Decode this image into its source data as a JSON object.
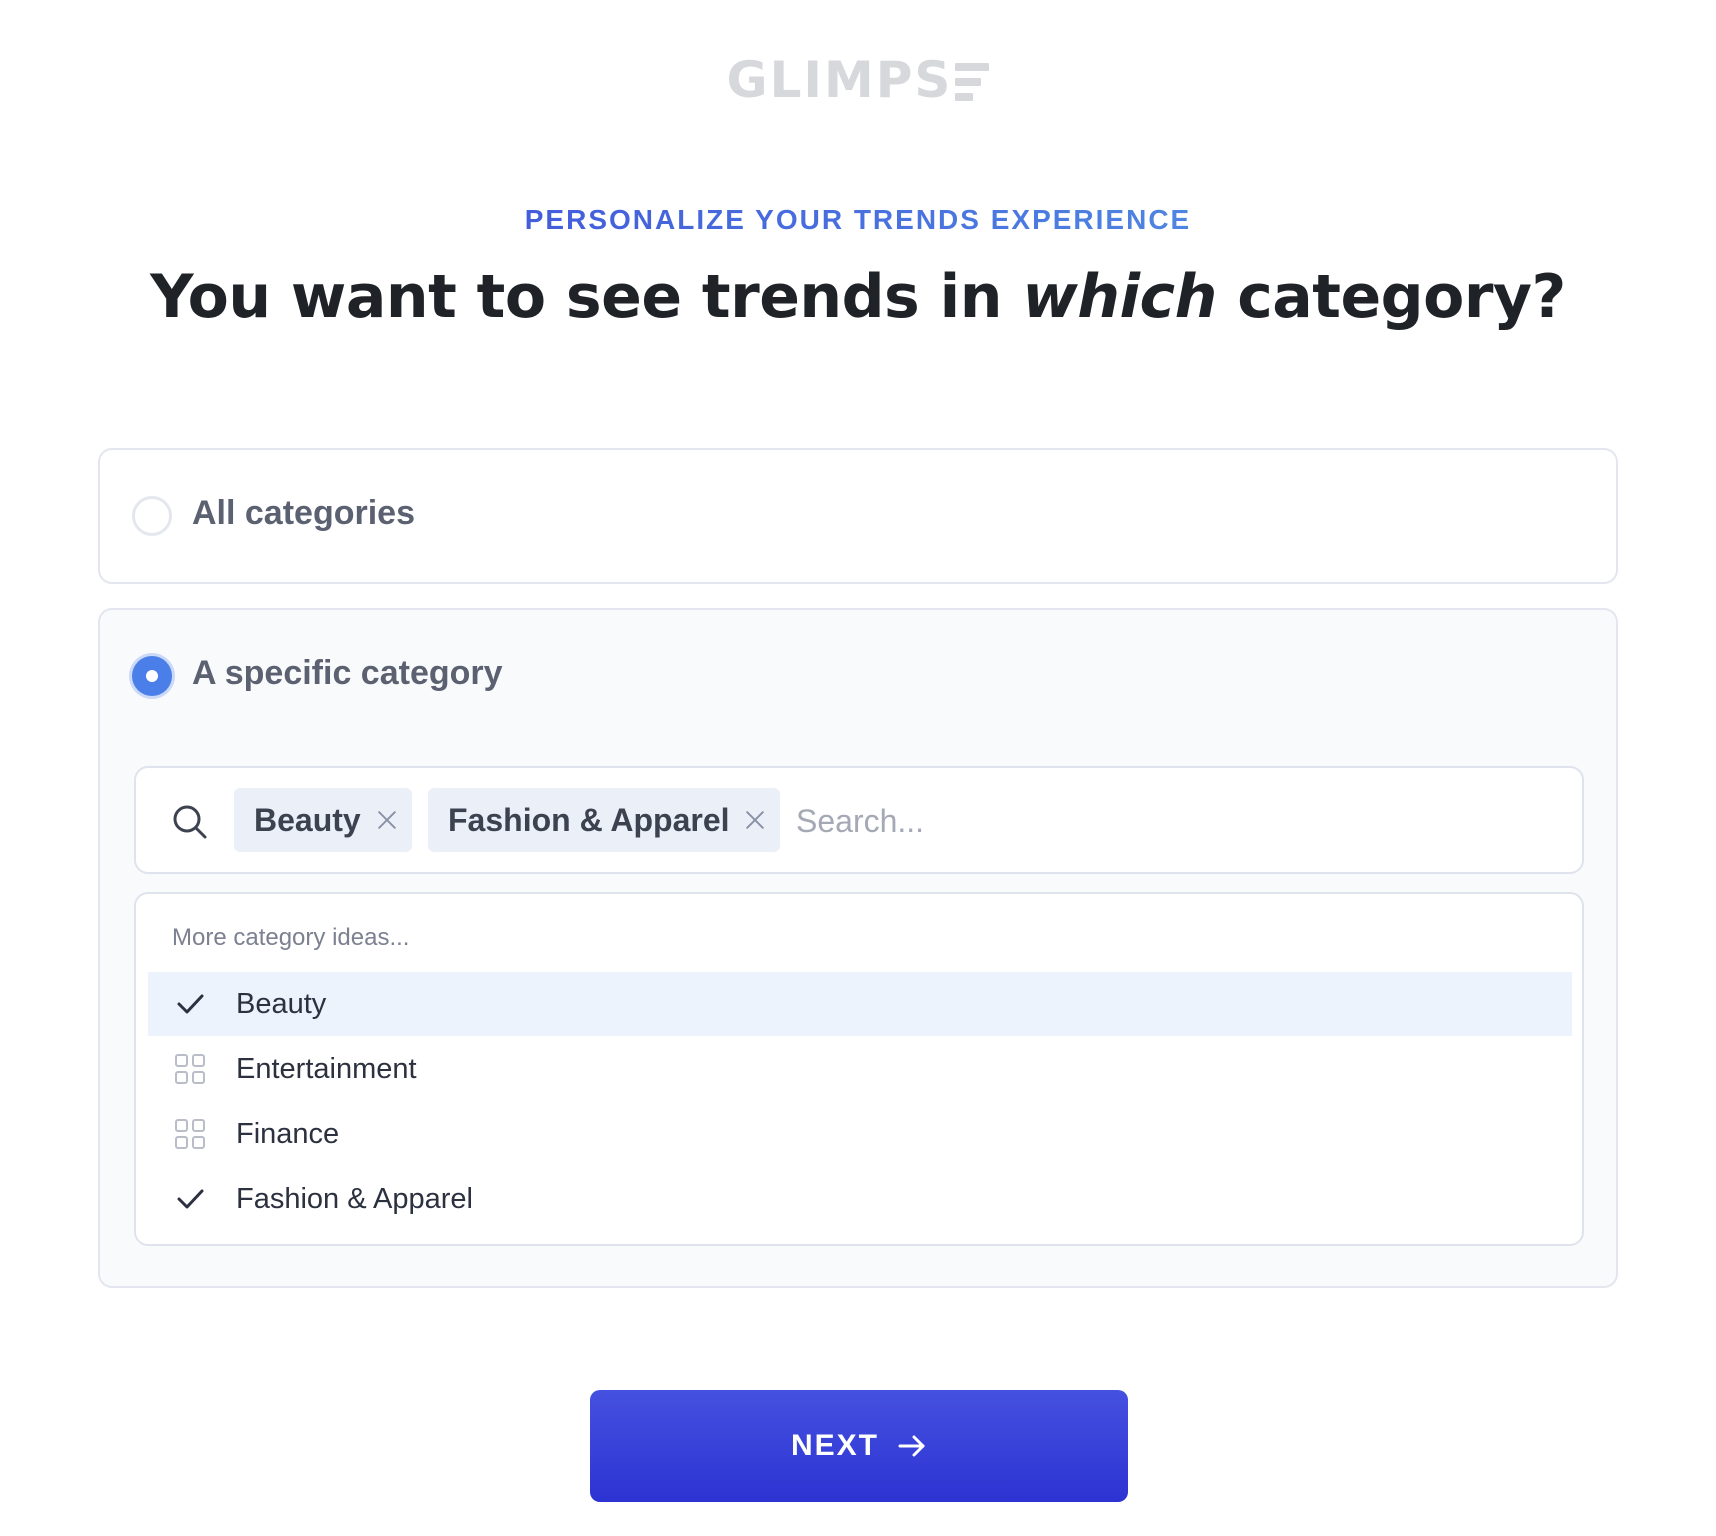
{
  "logo": {
    "text": "GLIMPS",
    "color": "#d7d8dc"
  },
  "header": {
    "eyebrow": "PERSONALIZE YOUR TRENDS EXPERIENCE",
    "title_before": "You want to see trends in ",
    "title_emphasis": "which",
    "title_after": " category?"
  },
  "options": {
    "all": {
      "label": "All categories",
      "selected": false
    },
    "specific": {
      "label": "A specific category",
      "selected": true
    }
  },
  "search": {
    "placeholder": "Search...",
    "value": "",
    "chips": [
      {
        "label": "Beauty"
      },
      {
        "label": "Fashion & Apparel"
      }
    ]
  },
  "dropdown": {
    "hint": "More category ideas...",
    "items": [
      {
        "label": "Beauty",
        "icon": "check-icon",
        "selected": true,
        "highlighted": true
      },
      {
        "label": "Entertainment",
        "icon": "grid-icon",
        "selected": false,
        "highlighted": false
      },
      {
        "label": "Finance",
        "icon": "grid-icon",
        "selected": false,
        "highlighted": false
      },
      {
        "label": "Fashion & Apparel",
        "icon": "check-icon",
        "selected": true,
        "highlighted": false
      }
    ]
  },
  "footer": {
    "next_label": "NEXT",
    "next_icon": "arrow-right-icon"
  },
  "colors": {
    "accent": "#4a7ee8",
    "button": "#3038d6",
    "eyebrow_start": "#3b3fd6",
    "eyebrow_end": "#5aa8e8",
    "highlight_row": "#ecf3fd",
    "chip_bg": "#ebf0f8"
  }
}
